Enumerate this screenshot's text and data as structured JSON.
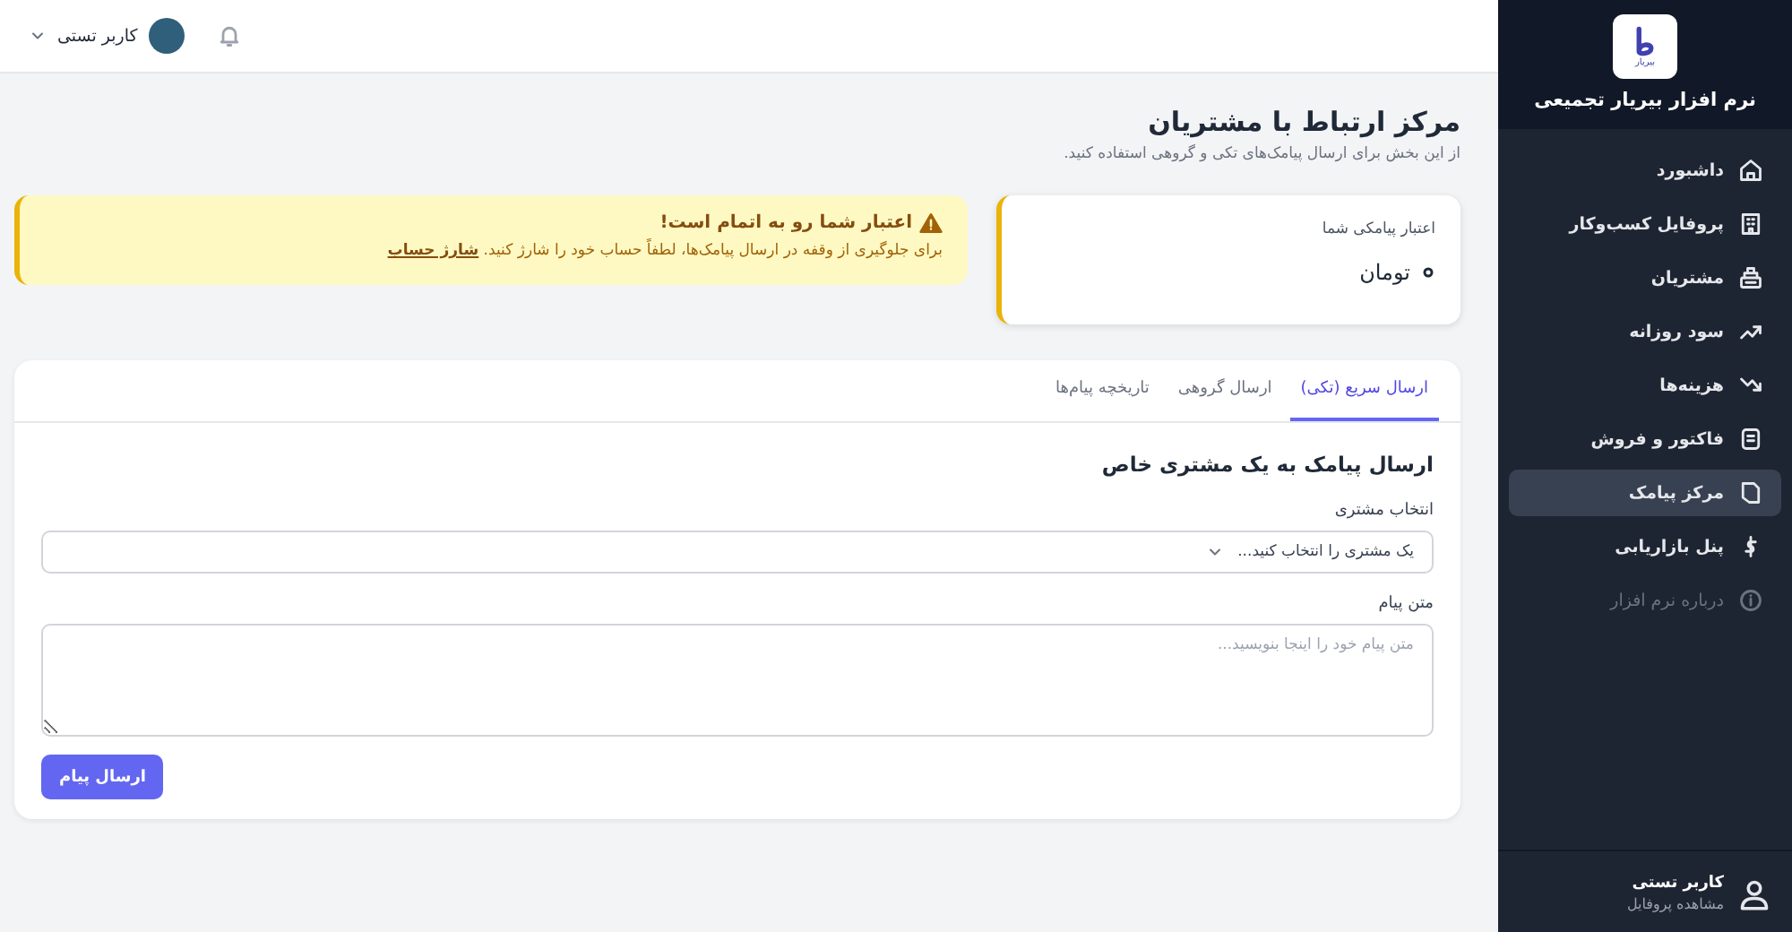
{
  "sidebar": {
    "logo_text": "بیریار",
    "app_name": "نرم افزار بیریار تجمیعی",
    "items": [
      {
        "label": "داشبورد",
        "selected": false,
        "dimmed": false
      },
      {
        "label": "پروفایل کسب‌وکار",
        "selected": false,
        "dimmed": false
      },
      {
        "label": "مشتریان",
        "selected": false,
        "dimmed": false
      },
      {
        "label": "سود روزانه",
        "selected": false,
        "dimmed": false
      },
      {
        "label": "هزینه‌ها",
        "selected": false,
        "dimmed": false
      },
      {
        "label": "فاکتور و فروش",
        "selected": false,
        "dimmed": false
      },
      {
        "label": "مرکز پیامک",
        "selected": true,
        "dimmed": false
      },
      {
        "label": "پنل بازاریابی",
        "selected": false,
        "dimmed": false
      },
      {
        "label": "درباره نرم افزار",
        "selected": false,
        "dimmed": true
      }
    ],
    "user": {
      "name": "کاربر تستی",
      "link": "مشاهده پروفایل"
    }
  },
  "topbar": {
    "user_name": "کاربر تستی"
  },
  "page": {
    "title": "مرکز ارتباط با مشتریان",
    "subtitle": "از این بخش برای ارسال پیامک‌های تکی و گروهی استفاده کنید."
  },
  "credit_card": {
    "label": "اعتبار پیامکی شما",
    "currency": "تومان"
  },
  "warning": {
    "title": "اعتبار شما رو به اتمام است!",
    "text": "برای جلوگیری از وقفه در ارسال پیامک‌ها، لطفاً حساب خود را شارژ کنید.",
    "link": "شارژ حساب"
  },
  "tabs": [
    {
      "label": "ارسال سریع (تکی)",
      "selected": true
    },
    {
      "label": "ارسال گروهی",
      "selected": false
    },
    {
      "label": "تاریخچه پیام‌ها",
      "selected": false
    }
  ],
  "form": {
    "heading": "ارسال پیامک به یک مشتری خاص",
    "customer_label": "انتخاب مشتری",
    "customer_placeholder": "یک مشتری را انتخاب کنید...",
    "message_label": "متن پیام",
    "message_placeholder": "متن پیام خود را اینجا بنویسید...",
    "submit": "ارسال پیام"
  }
}
